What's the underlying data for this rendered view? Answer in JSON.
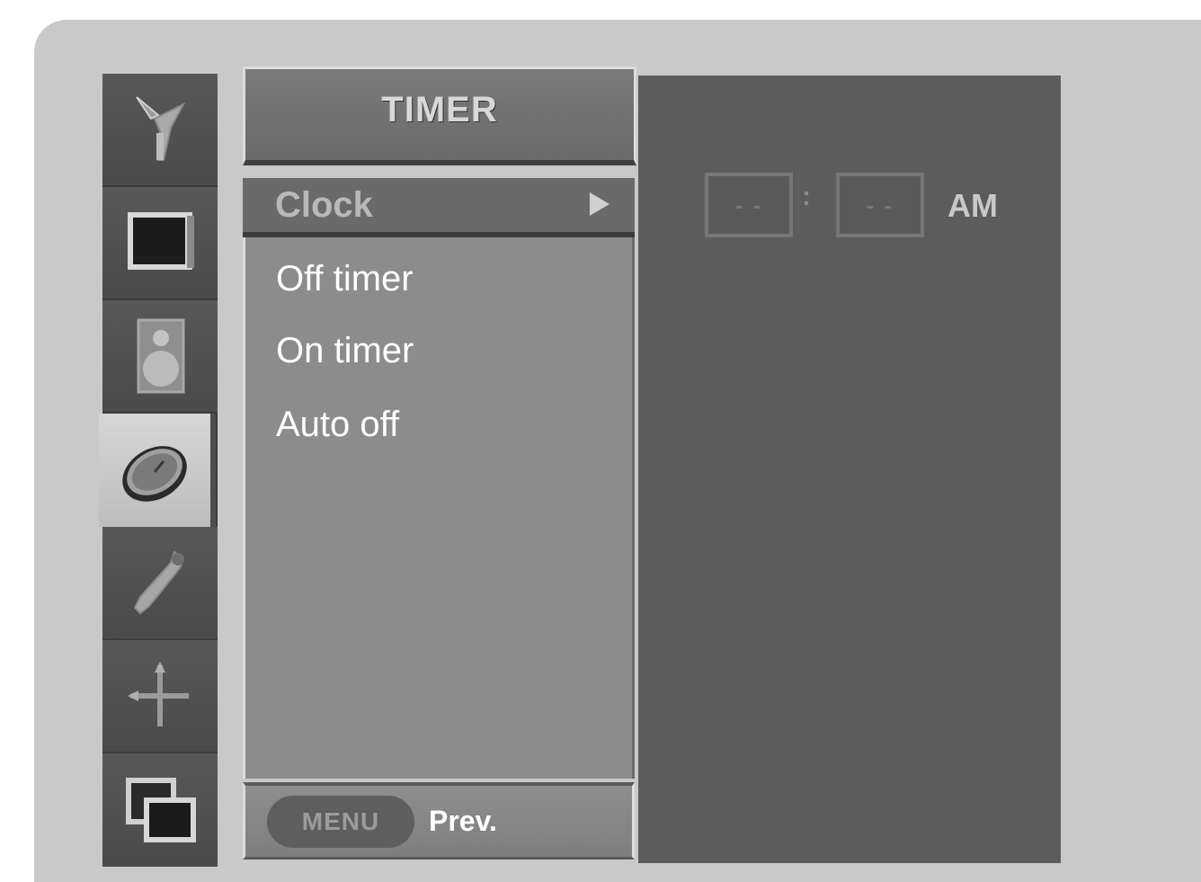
{
  "menu": {
    "title": "TIMER",
    "items": [
      {
        "label": "Clock",
        "selected": true
      },
      {
        "label": "Off timer",
        "selected": false
      },
      {
        "label": "On timer",
        "selected": false
      },
      {
        "label": "Auto off",
        "selected": false
      }
    ],
    "footer": {
      "button_label": "MENU",
      "prev_label": "Prev."
    }
  },
  "clock": {
    "hour": "- -",
    "minute": "- -",
    "separator": ":",
    "ampm": "AM"
  },
  "sidebar": {
    "icons": [
      {
        "name": "station-icon"
      },
      {
        "name": "picture-icon"
      },
      {
        "name": "sound-icon"
      },
      {
        "name": "timer-icon",
        "active": true
      },
      {
        "name": "special-icon"
      },
      {
        "name": "screen-adjust-icon"
      },
      {
        "name": "pip-icon"
      }
    ]
  },
  "colors": {
    "background": "#c9c9c9",
    "menu_body": "#8c8c8c",
    "value_panel": "#5c5c5c",
    "icon_column": "#4e4e4e"
  }
}
